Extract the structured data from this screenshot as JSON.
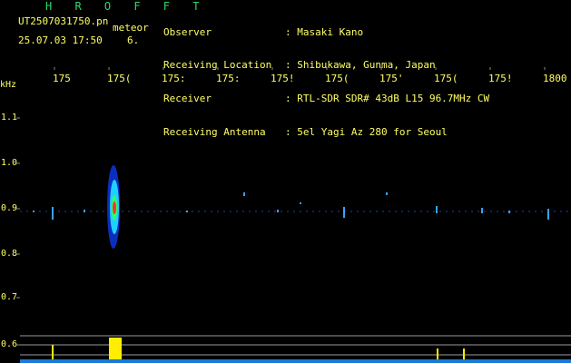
{
  "header": {
    "title": "H R O F F T",
    "filename": "UT2507031750.pn",
    "detection_type": "meteor",
    "datetime": "25.07.03 17:50",
    "count": "6.",
    "info": [
      {
        "key": "Observer",
        "value": ": Masaki Kano"
      },
      {
        "key": "Receiving Location",
        "value": ": Shibukawa, Gunma, Japan"
      },
      {
        "key": "Receiver",
        "value": ": RTL-SDR SDR# 43dB L15 96.7MHz CW"
      },
      {
        "key": "Receiving Antenna",
        "value": ": 5el Yagi Az 280 for Seoul"
      }
    ]
  },
  "spectrogram": {
    "freq_unit": "kHz",
    "time_ticks": [
      "175",
      "175(",
      "175:",
      "175:",
      "175!",
      "175(",
      "175'",
      "175(",
      "175!",
      "1800"
    ],
    "freq_labels": [
      "1.1",
      "1.0",
      "0.9",
      "0.8",
      "0.7",
      "0.6"
    ],
    "colors": {
      "text": "#ffff66",
      "title": "#2fd86a",
      "grid": "#9a9a9a",
      "echo_core": "#ff3030",
      "noise": "#3aa0ff",
      "level": "#ffee00"
    }
  }
}
